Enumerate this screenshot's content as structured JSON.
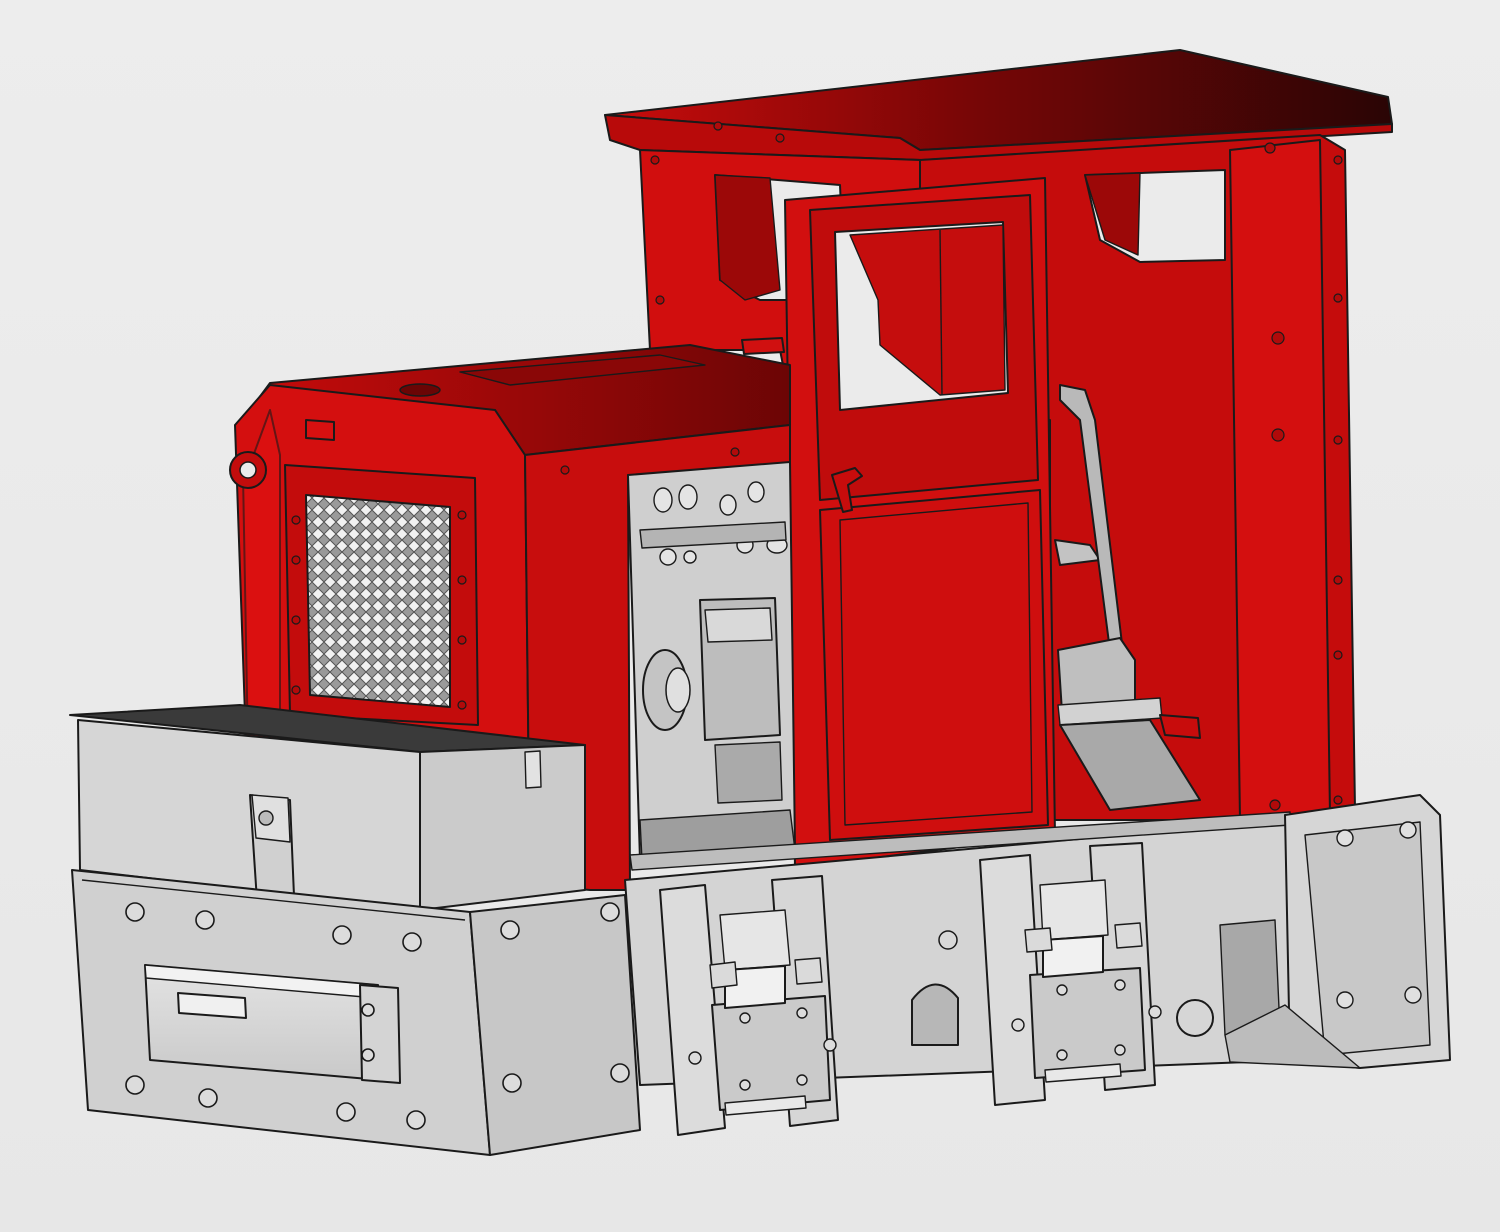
{
  "scene": {
    "subject": "model-locomotive",
    "colors": {
      "background": "#ebebeb",
      "body_red": "#cc0d0d",
      "body_red_dark": "#8e0606",
      "roof_dark": "#3a0a0a",
      "frame_grey": "#d9d9d9",
      "frame_grey_dark": "#a8a8a8",
      "outline": "#1a1a1a"
    }
  }
}
